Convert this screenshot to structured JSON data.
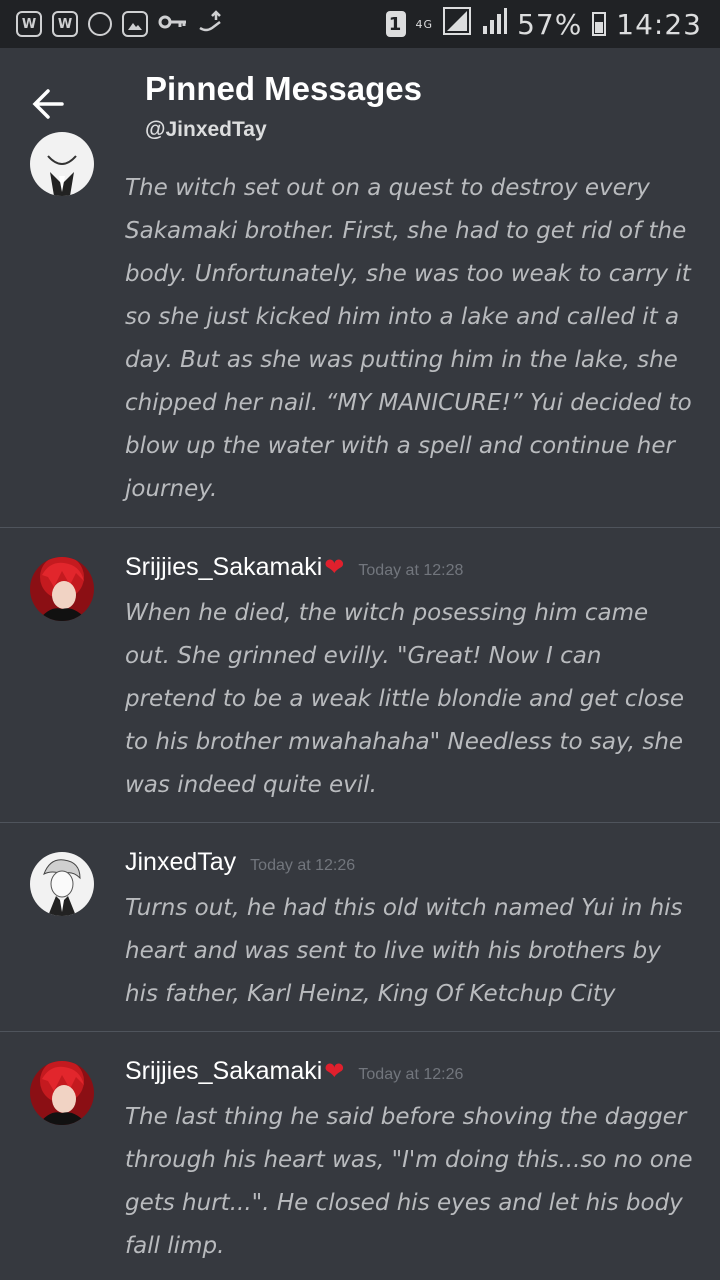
{
  "status_bar": {
    "left_icons": [
      "mail-icon",
      "mail-icon",
      "circle-icon",
      "image-icon",
      "key-icon",
      "sync-icon"
    ],
    "sim": "1",
    "network": "4G",
    "battery": "57%",
    "time": "14:23"
  },
  "header": {
    "title": "Pinned Messages",
    "subtitle": "@JinxedTay"
  },
  "messages": [
    {
      "author": "",
      "timestamp": "",
      "text": "The witch set out on a quest to destroy every Sakamaki brother. First, she had to get rid of the body. Unfortunately, she was too weak to carry it so she just kicked him into a lake and called it a day. But as she was putting him in the lake, she chipped her nail. “MY MANICURE!” Yui decided to blow up the water with a spell and continue her journey."
    },
    {
      "author": "Srijjies_Sakamaki",
      "author_emoji": "❤",
      "timestamp": "Today at 12:28",
      "text": "When he died, the witch posessing him came out. She grinned evilly. \"Great! Now I can pretend to be a weak little blondie and get close to his brother mwahahaha\" Needless to say, she was indeed quite evil."
    },
    {
      "author": "JinxedTay",
      "timestamp": "Today at 12:26",
      "text": "Turns out, he had this old witch named Yui in his heart and was sent to live with his brothers by his father, Karl Heinz, King Of Ketchup City"
    },
    {
      "author": "Srijjies_Sakamaki",
      "author_emoji": "❤",
      "timestamp": "Today at 12:26",
      "text": "The last thing he said before shoving the dagger through his heart was, \"I'm doing this...so no one gets hurt...\". He closed his eyes and let his body fall limp."
    }
  ],
  "colors": {
    "background": "#36393f",
    "status_bar": "#202225",
    "divider": "#4f545c",
    "message_text": "#b9bbbe",
    "timestamp": "#72767d"
  }
}
